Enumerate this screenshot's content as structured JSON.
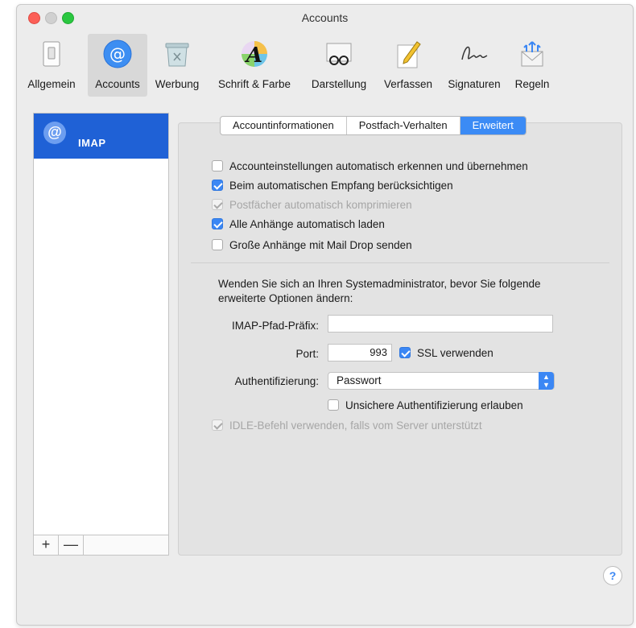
{
  "window": {
    "title": "Accounts"
  },
  "toolbar": {
    "items": [
      {
        "label": "Allgemein",
        "icon": "switch-icon"
      },
      {
        "label": "Accounts",
        "icon": "at-sign-icon",
        "selected": true
      },
      {
        "label": "Werbung",
        "icon": "junk-trash-icon"
      },
      {
        "label": "Schrift & Farbe",
        "icon": "font-color-icon"
      },
      {
        "label": "Darstellung",
        "icon": "glasses-icon"
      },
      {
        "label": "Verfassen",
        "icon": "pencil-icon"
      },
      {
        "label": "Signaturen",
        "icon": "signature-icon"
      },
      {
        "label": "Regeln",
        "icon": "rules-envelope-icon"
      }
    ]
  },
  "sidebar": {
    "accounts": [
      {
        "label": "IMAP",
        "icon": "@",
        "selected": true
      }
    ],
    "add_label": "+",
    "remove_label": "—"
  },
  "tabs": [
    {
      "label": "Accountinformationen",
      "active": false
    },
    {
      "label": "Postfach-Verhalten",
      "active": false
    },
    {
      "label": "Erweitert",
      "active": true
    }
  ],
  "options": [
    {
      "label": "Accounteinstellungen automatisch erkennen und übernehmen",
      "checked": false,
      "enabled": true
    },
    {
      "label": "Beim automatischen Empfang berücksichtigen",
      "checked": true,
      "enabled": true
    },
    {
      "label": "Postfächer automatisch komprimieren",
      "checked": true,
      "enabled": false
    },
    {
      "label": "Alle Anhänge automatisch laden",
      "checked": true,
      "enabled": true
    },
    {
      "label": "Große Anhänge mit Mail Drop senden",
      "checked": false,
      "enabled": true
    }
  ],
  "advanced": {
    "notice": "Wenden Sie sich an Ihren Systemadministrator, bevor Sie folgende erweiterte Optionen ändern:",
    "imap_prefix_label": "IMAP-Pfad-Präfix:",
    "imap_prefix_value": "",
    "port_label": "Port:",
    "port_value": "993",
    "ssl_label": "SSL verwenden",
    "ssl_checked": true,
    "auth_label": "Authentifizierung:",
    "auth_value": "Passwort",
    "insecure_auth_label": "Unsichere Authentifizierung erlauben",
    "insecure_auth_checked": false,
    "idle_label": "IDLE-Befehl verwenden, falls vom Server unterstützt",
    "idle_checked": true,
    "idle_enabled": false
  },
  "help_label": "?",
  "colors": {
    "accent": "#3b87f4",
    "selection": "#1f61d6"
  }
}
